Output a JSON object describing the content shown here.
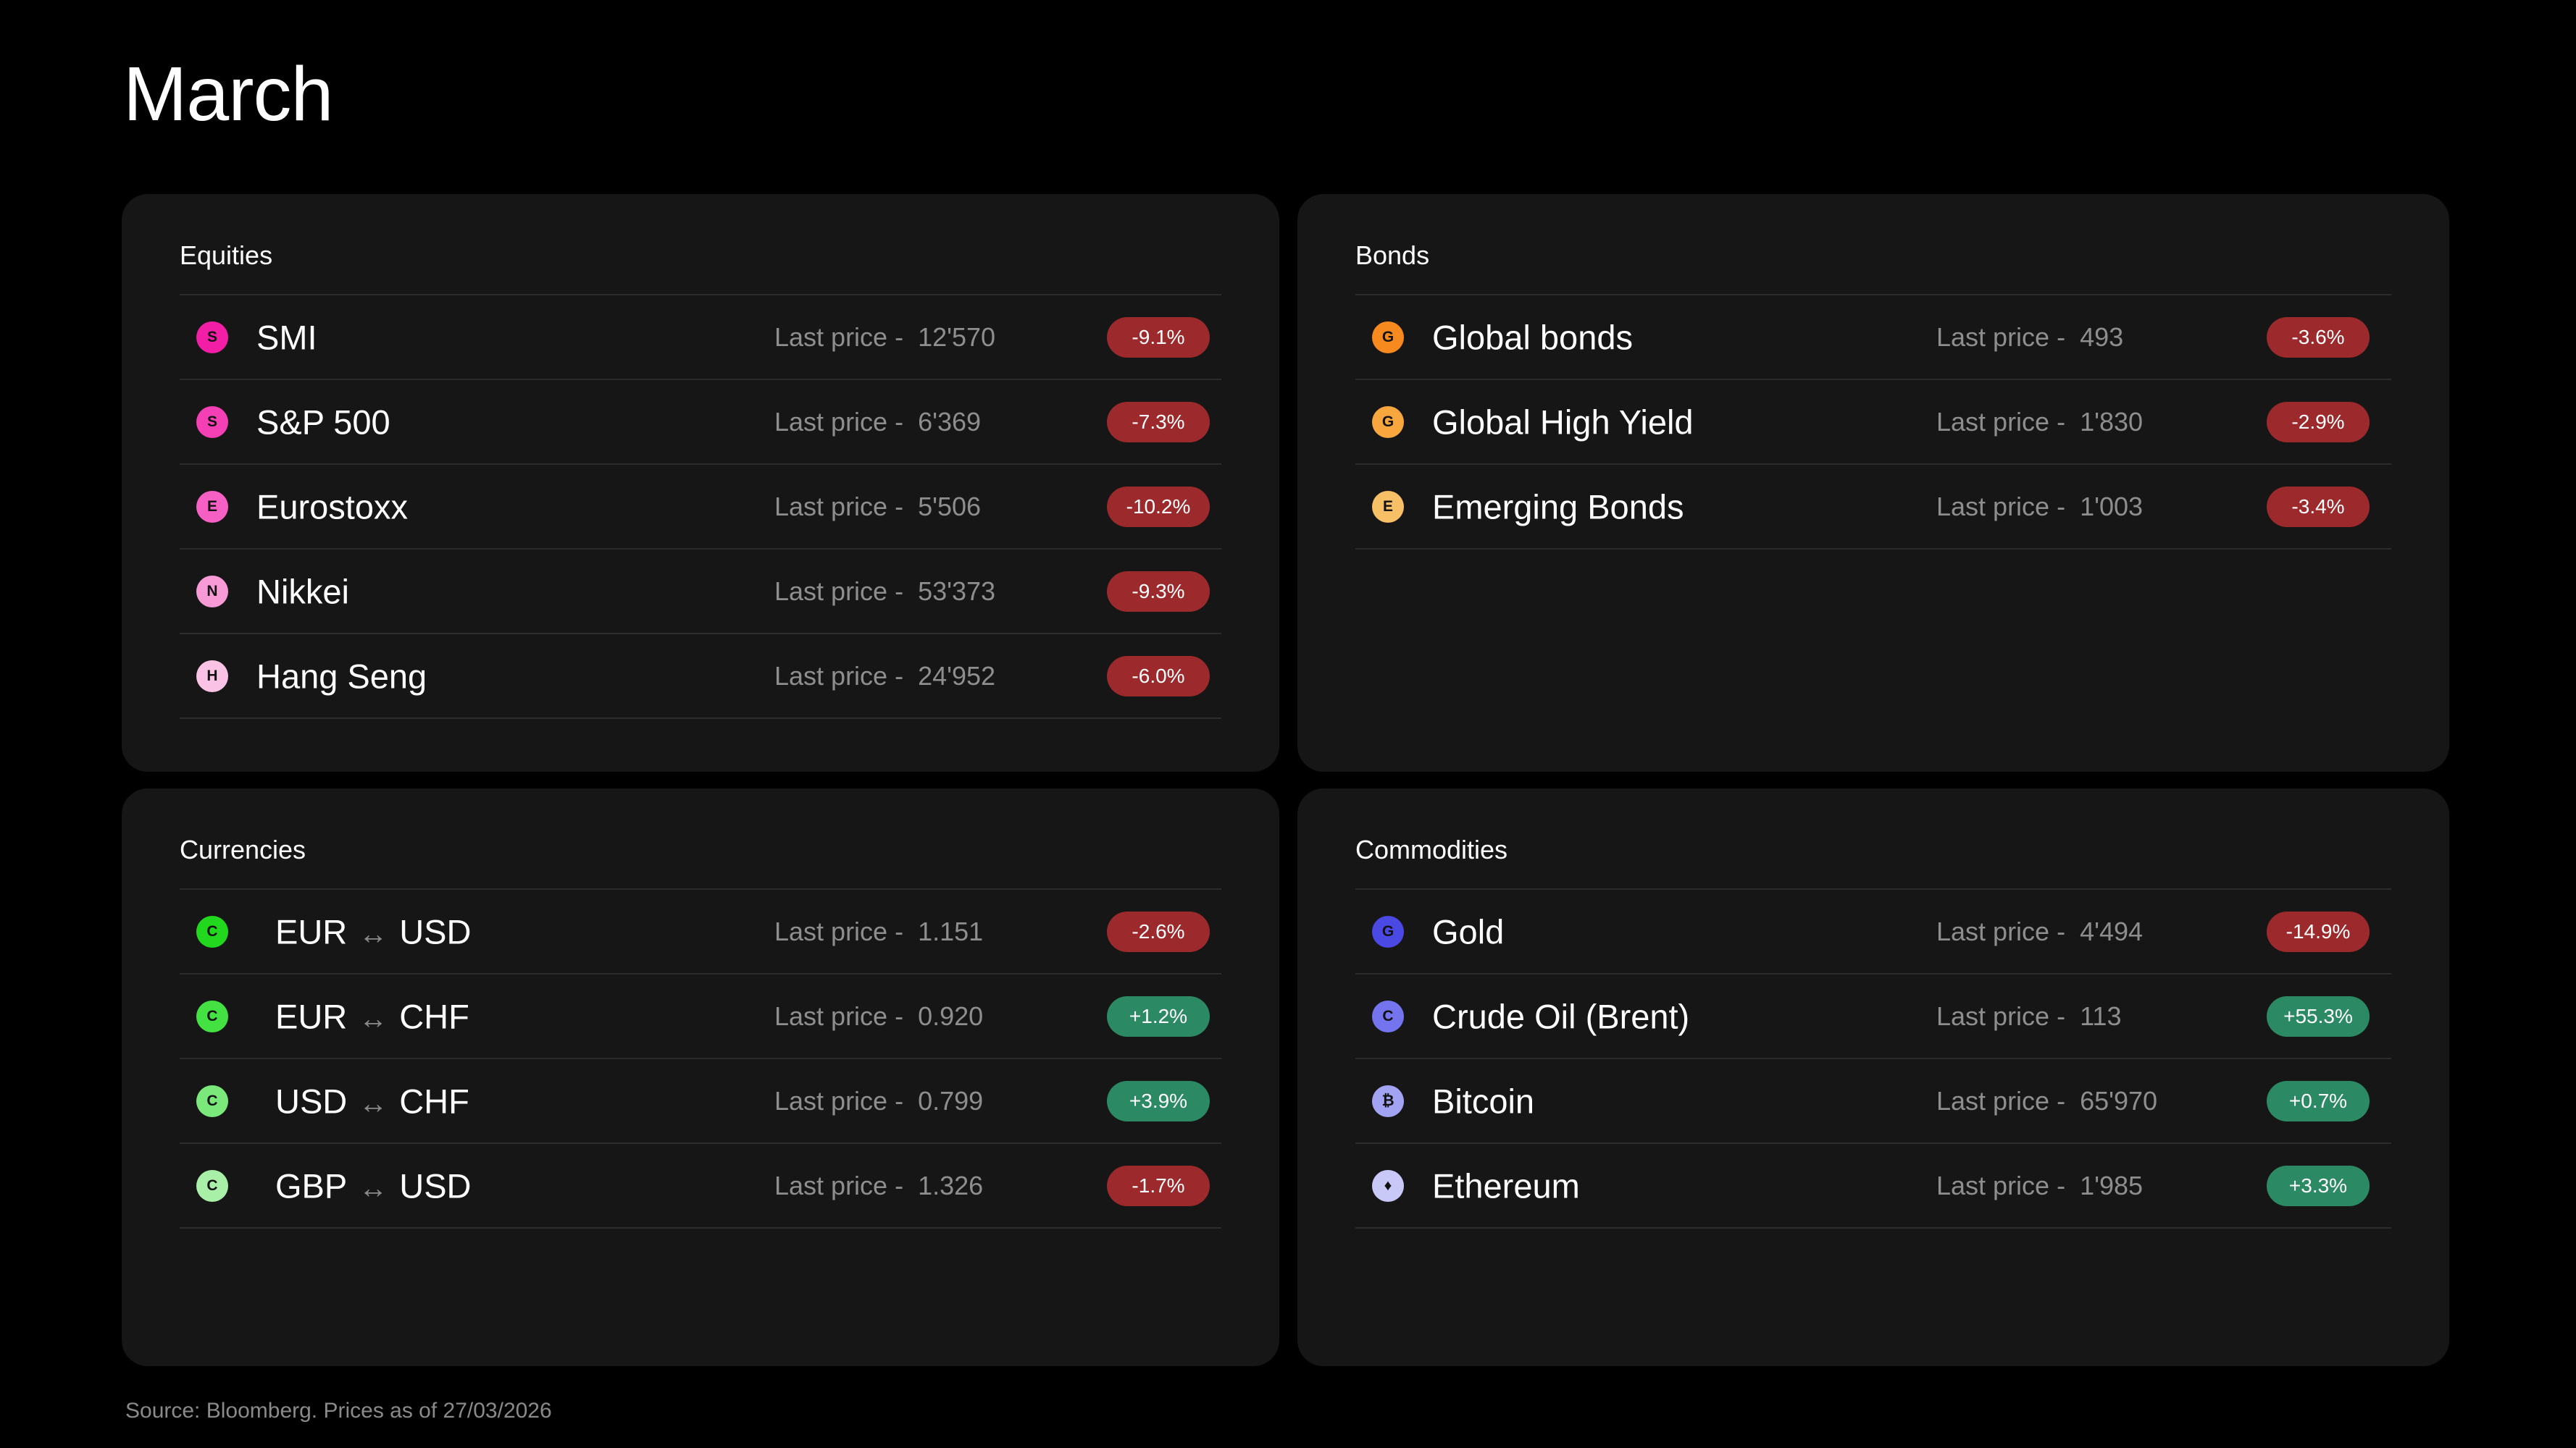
{
  "page": {
    "title": "March",
    "source": "Source: Bloomberg. Prices as of 27/03/2026"
  },
  "colors": {
    "negative": "#9c2a2c",
    "positive": "#2b8a63",
    "card": "#161616",
    "background": "#000000"
  },
  "price_label": "Last price -",
  "equities": {
    "title": "Equities",
    "rows": [
      {
        "letter": "S",
        "name": "SMI",
        "price": "12'570",
        "change": "-9.1%",
        "dir": "neg",
        "color": "#f21fa6"
      },
      {
        "letter": "S",
        "name": "S&P 500",
        "price": "6'369",
        "change": "-7.3%",
        "dir": "neg",
        "color": "#f43fb5"
      },
      {
        "letter": "E",
        "name": "Eurostoxx",
        "price": "5'506",
        "change": "-10.2%",
        "dir": "neg",
        "color": "#f65fc3"
      },
      {
        "letter": "N",
        "name": "Nikkei",
        "price": "53'373",
        "change": "-9.3%",
        "dir": "neg",
        "color": "#f89ad6"
      },
      {
        "letter": "H",
        "name": "Hang Seng",
        "price": "24'952",
        "change": "-6.0%",
        "dir": "neg",
        "color": "#fac3e6"
      }
    ]
  },
  "bonds": {
    "title": "Bonds",
    "rows": [
      {
        "letter": "G",
        "name": "Global bonds",
        "price": "493",
        "change": "-3.6%",
        "dir": "neg",
        "color": "#f68a1e"
      },
      {
        "letter": "G",
        "name": "Global High Yield",
        "price": "1'830",
        "change": "-2.9%",
        "dir": "neg",
        "color": "#f7a73e"
      },
      {
        "letter": "E",
        "name": "Emerging Bonds",
        "price": "1'003",
        "change": "-3.4%",
        "dir": "neg",
        "color": "#f8c066"
      }
    ]
  },
  "currencies": {
    "title": "Currencies",
    "rows": [
      {
        "letter": "C",
        "from": "EUR",
        "to": "USD",
        "arrow": "↔",
        "price": "1.151",
        "change": "-2.6%",
        "dir": "neg",
        "color": "#22d81e"
      },
      {
        "letter": "C",
        "from": "EUR",
        "to": "CHF",
        "arrow": "↔",
        "price": "0.920",
        "change": "+1.2%",
        "dir": "pos",
        "color": "#43e142"
      },
      {
        "letter": "C",
        "from": "USD",
        "to": "CHF",
        "arrow": "↔",
        "price": "0.799",
        "change": "+3.9%",
        "dir": "pos",
        "color": "#7ae87a"
      },
      {
        "letter": "C",
        "from": "GBP",
        "to": "USD",
        "arrow": "↔",
        "price": "1.326",
        "change": "-1.7%",
        "dir": "neg",
        "color": "#a8f0a8"
      }
    ]
  },
  "commodities": {
    "title": "Commodities",
    "rows": [
      {
        "letter": "G",
        "name": "Gold",
        "price": "4'494",
        "change": "-14.9%",
        "dir": "neg",
        "color": "#4a49e3"
      },
      {
        "letter": "C",
        "name": "Crude Oil (Brent)",
        "price": "113",
        "change": "+55.3%",
        "dir": "pos",
        "color": "#7474ef"
      },
      {
        "letter": "₿",
        "name": "Bitcoin",
        "price": "65'970",
        "change": "+0.7%",
        "dir": "pos",
        "color": "#a3a3f4"
      },
      {
        "letter": "♦",
        "name": "Ethereum",
        "price": "1'985",
        "change": "+3.3%",
        "dir": "pos",
        "color": "#c9c9f8"
      }
    ]
  }
}
